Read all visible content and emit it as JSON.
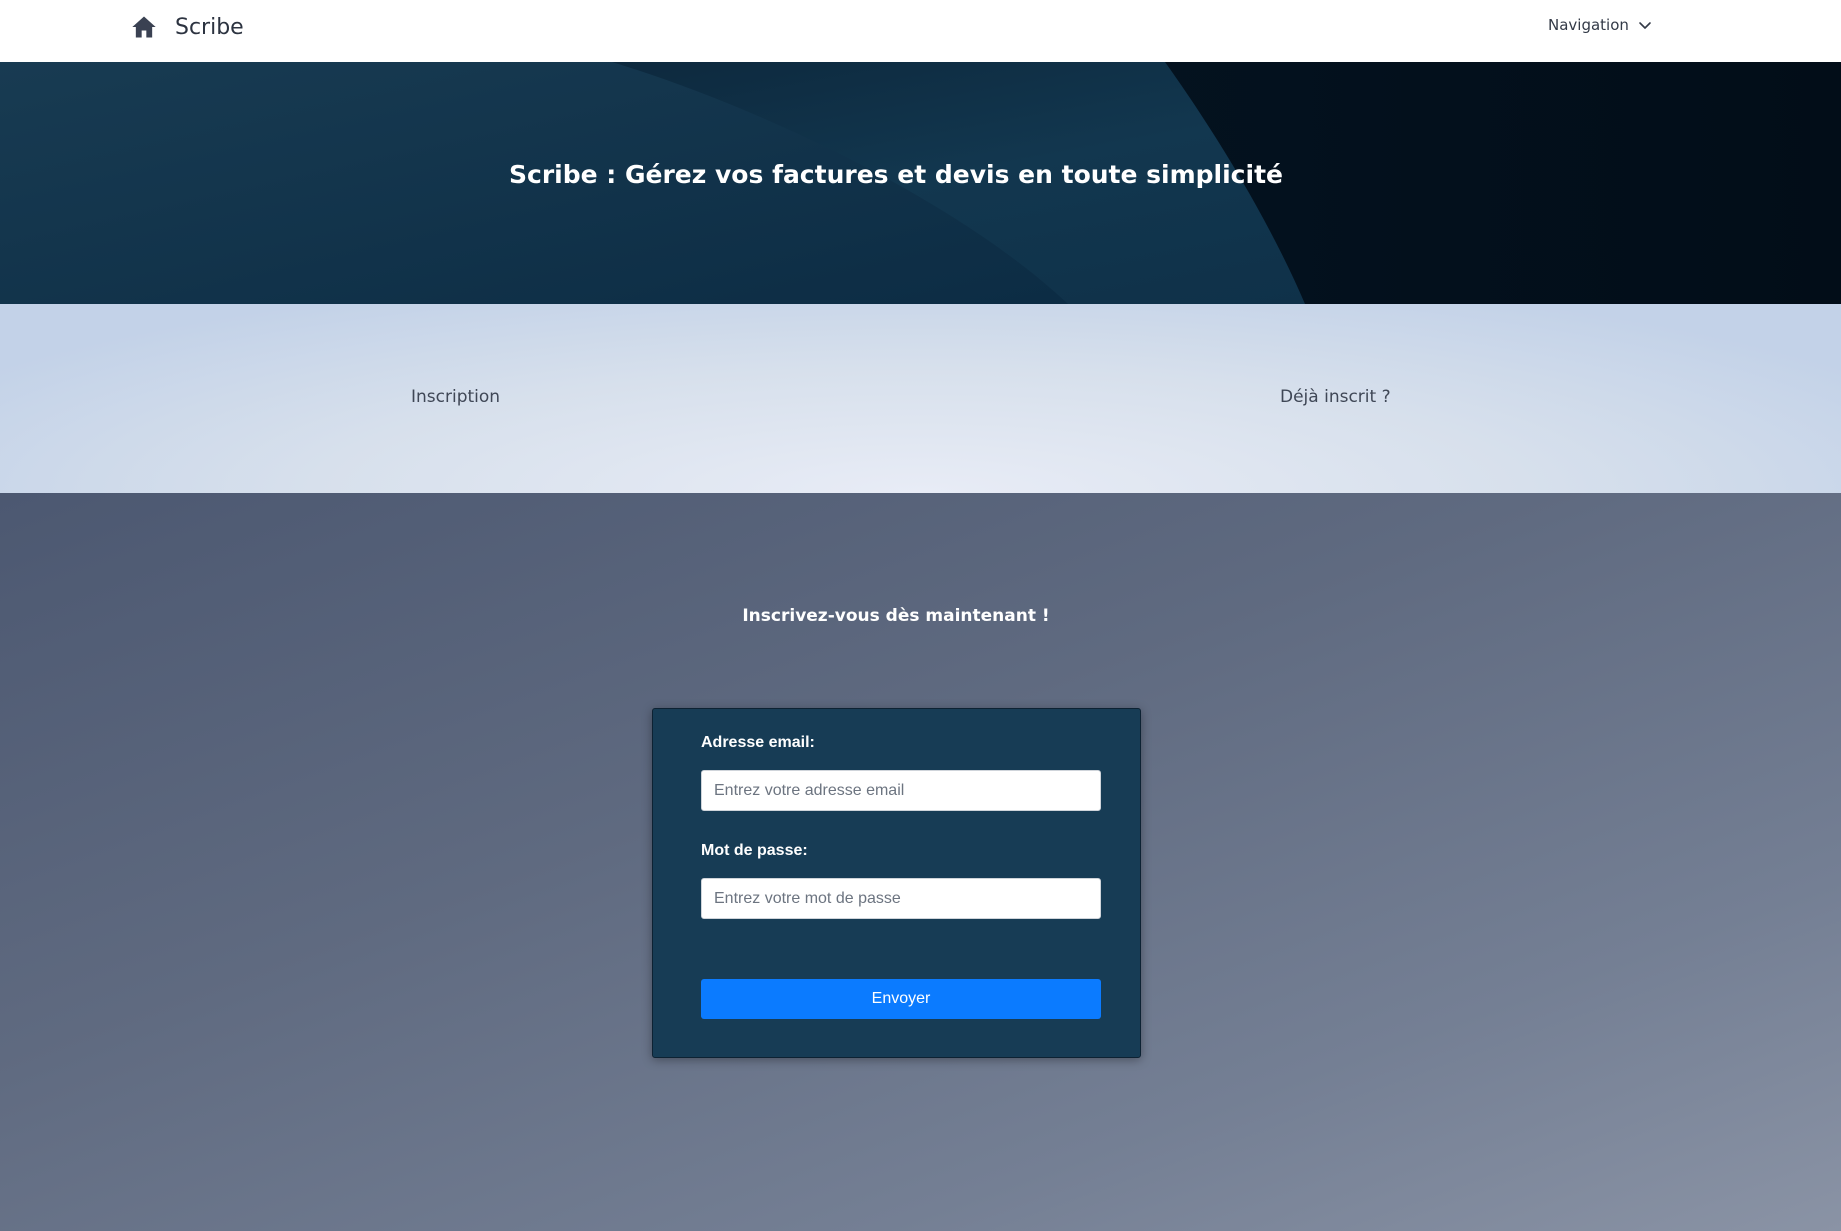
{
  "navbar": {
    "brand_name": "Scribe",
    "home_icon": "home-icon",
    "navigation_label": "Navigation",
    "navigation_icon": "chevron-down-icon"
  },
  "hero": {
    "title": "Scribe : Gérez vos factures et devis en toute simplicité"
  },
  "links": {
    "inscription": "Inscription",
    "deja_inscrit": "Déjà inscrit ?"
  },
  "form": {
    "heading": "Inscrivez-vous dès maintenant !",
    "email_label": "Adresse email:",
    "email_placeholder": "Entrez votre adresse email",
    "email_value": "",
    "password_label": "Mot de passe:",
    "password_placeholder": "Entrez votre mot de passe",
    "password_value": "",
    "submit_label": "Envoyer"
  },
  "colors": {
    "hero_background": "#031627",
    "card_background": "#173c55",
    "button_accent": "#0b7bff"
  }
}
